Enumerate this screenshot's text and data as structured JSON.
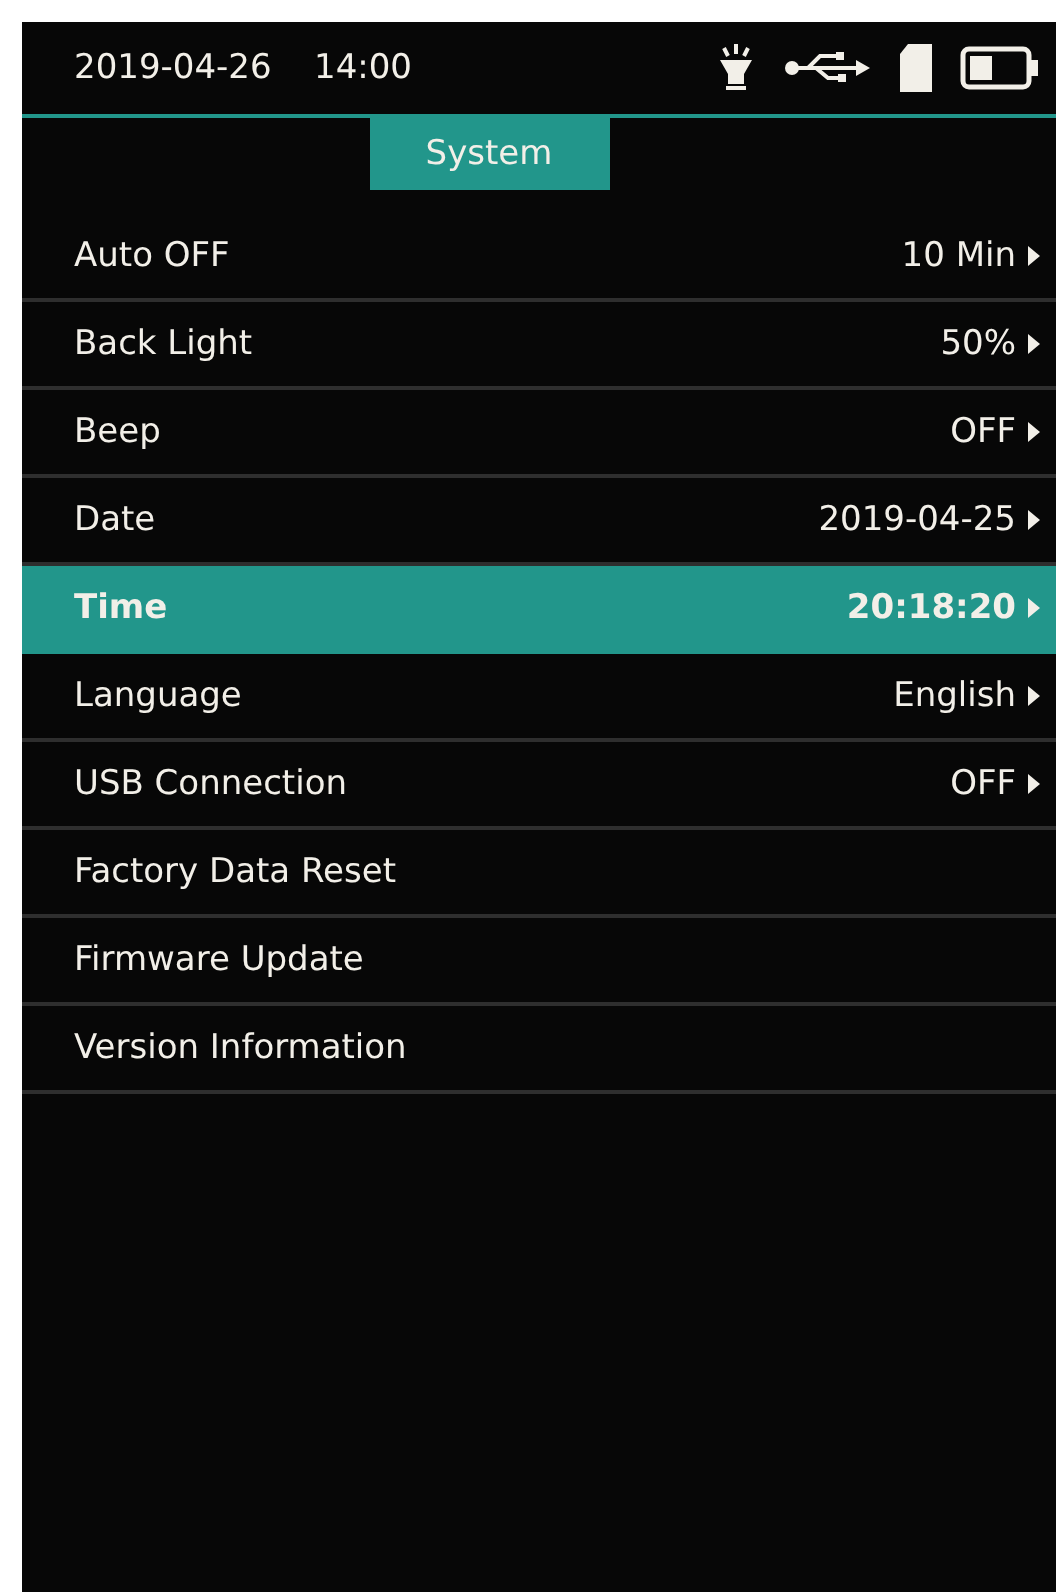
{
  "status_bar": {
    "date": "2019-04-26",
    "time": "14:00"
  },
  "tab": {
    "label": "System",
    "selected": true
  },
  "menu": [
    {
      "label": "Auto OFF",
      "value": "10 Min",
      "selected": false
    },
    {
      "label": "Back Light",
      "value": "50%",
      "selected": false
    },
    {
      "label": "Beep",
      "value": "OFF",
      "selected": false
    },
    {
      "label": "Date",
      "value": "2019-04-25",
      "selected": false
    },
    {
      "label": "Time",
      "value": "20:18:20",
      "selected": true
    },
    {
      "label": "Language",
      "value": "English",
      "selected": false
    },
    {
      "label": "USB Connection",
      "value": "OFF",
      "selected": false
    },
    {
      "label": "Factory Data Reset",
      "selected": false
    },
    {
      "label": "Firmware Update",
      "selected": false
    },
    {
      "label": "Version Information",
      "selected": false
    }
  ]
}
